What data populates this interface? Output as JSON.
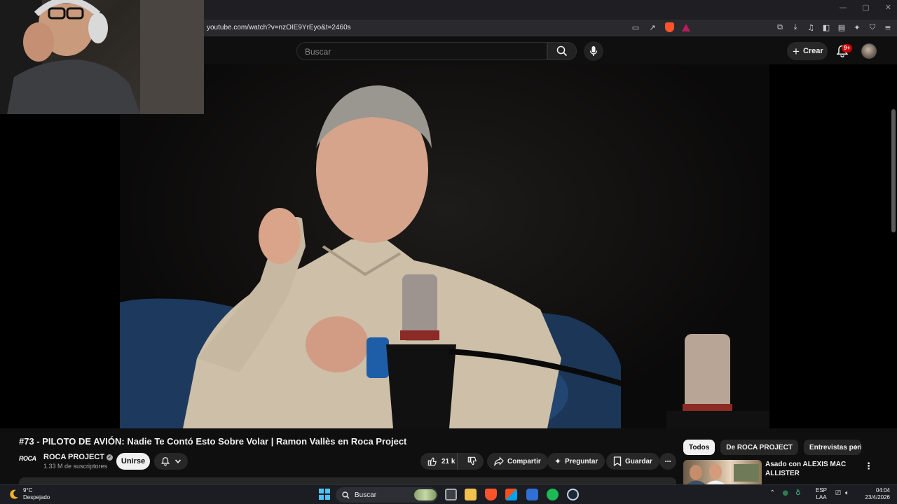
{
  "browser": {
    "url": "youtube.com/watch?v=nzOIE9YrEyo&t=2460s",
    "window_controls": [
      "—",
      "▢",
      "✕"
    ]
  },
  "youtube_header": {
    "search_placeholder": "Buscar",
    "create_label": "Crear",
    "notifications_badge": "9+"
  },
  "video": {
    "title": "#73 - PILOTO DE AVIÓN: Nadie Te Contó Esto Sobre Volar | Ramon Vallès en Roca Project",
    "channel_logo_text": "ROCA",
    "channel_name": "ROCA PROJECT",
    "subscribers": "1.33 M de suscriptores",
    "join_label": "Unirse",
    "likes": "21 k",
    "share_label": "Compartir",
    "ask_label": "Preguntar",
    "save_label": "Guardar",
    "more_label": "···"
  },
  "sidebar": {
    "chips": [
      "Todos",
      "De ROCA PROJECT",
      "Entrevistas period"
    ],
    "recommendation_title": "Asado con ALEXIS MAC ALLISTER",
    "menu_label": "⋮"
  },
  "taskbar": {
    "temperature": "9°C",
    "condition": "Despejado",
    "search_label": "Buscar",
    "lang_line1": "ESP",
    "lang_line2": "LAA",
    "time": "04:04",
    "date": "23/4/2026"
  },
  "colors": {
    "youtube_bg": "#0f0f0f",
    "pill_bg": "#272727",
    "accent_red": "#cc0000",
    "taskbar_bg": "#1b1d22"
  }
}
